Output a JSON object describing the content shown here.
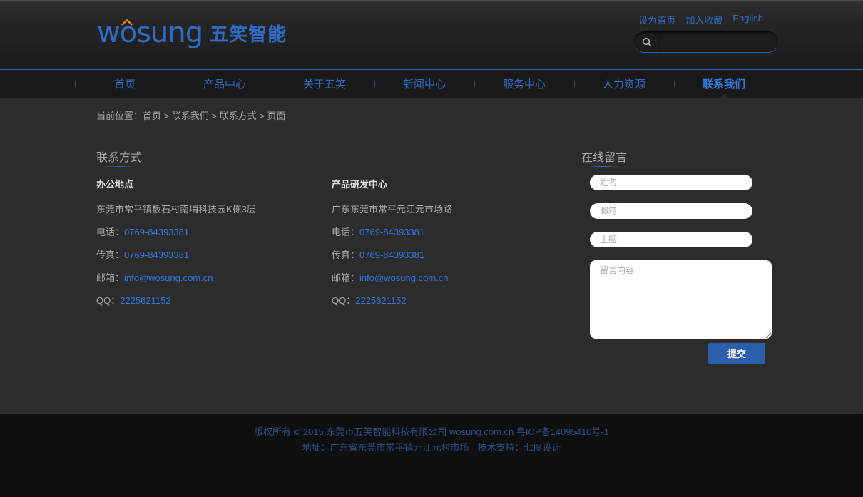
{
  "header": {
    "logo_text": "wosung",
    "logo_cn": "五笑智能",
    "top_links": [
      "设为首页",
      "加入收藏",
      "English"
    ],
    "search": {
      "placeholder": "",
      "value": ""
    }
  },
  "nav": {
    "items": [
      {
        "label": "首页",
        "active": false
      },
      {
        "label": "产品中心",
        "active": false
      },
      {
        "label": "关于五笑",
        "active": false
      },
      {
        "label": "新闻中心",
        "active": false
      },
      {
        "label": "服务中心",
        "active": false
      },
      {
        "label": "人力资源",
        "active": false
      },
      {
        "label": "联系我们",
        "active": true
      }
    ]
  },
  "breadcrumb": {
    "prefix": "当前位置：",
    "items": [
      "首页",
      "联系我们",
      "联系方式",
      "页面"
    ],
    "separator": " > "
  },
  "contact": {
    "title": "联系方式",
    "columns": [
      {
        "heading": "办公地点",
        "address": "东莞市常平镇板石村南埔科技园K栋3层",
        "phone_label": "电话：",
        "phone": "0769-84393381",
        "fax_label": "传真：",
        "fax": "0769-84393381",
        "email_label": "邮箱：",
        "email": "info@wosung.com.cn",
        "qq_label": "QQ：",
        "qq": "2225621152"
      },
      {
        "heading": "产品研发中心",
        "address": "广东东莞市常平元江元市场路",
        "phone_label": "电话：",
        "phone": "0769-84393381",
        "fax_label": "传真：",
        "fax": "0769-84393381",
        "email_label": "邮箱：",
        "email": "info@wosung.com.cn",
        "qq_label": "QQ：",
        "qq": "2225621152"
      }
    ]
  },
  "message_form": {
    "title": "在线留言",
    "name_placeholder": "姓名",
    "email_placeholder": "邮箱",
    "subject_placeholder": "主题",
    "content_placeholder": "留言内容",
    "submit_label": "提交"
  },
  "footer": {
    "line1": "版权所有 © 2015 东莞市五笑智能科技有限公司 wosung.com.cn 粤ICP备14095410号-1",
    "address": "地址：广东省东莞市常平镇元江元村市场",
    "support": "技术支持：七度设计"
  },
  "colors": {
    "accent": "#2e6bc4",
    "link": "#2f76e0",
    "background": "#2c2c2c",
    "footer_bg": "#0f0f0f"
  }
}
